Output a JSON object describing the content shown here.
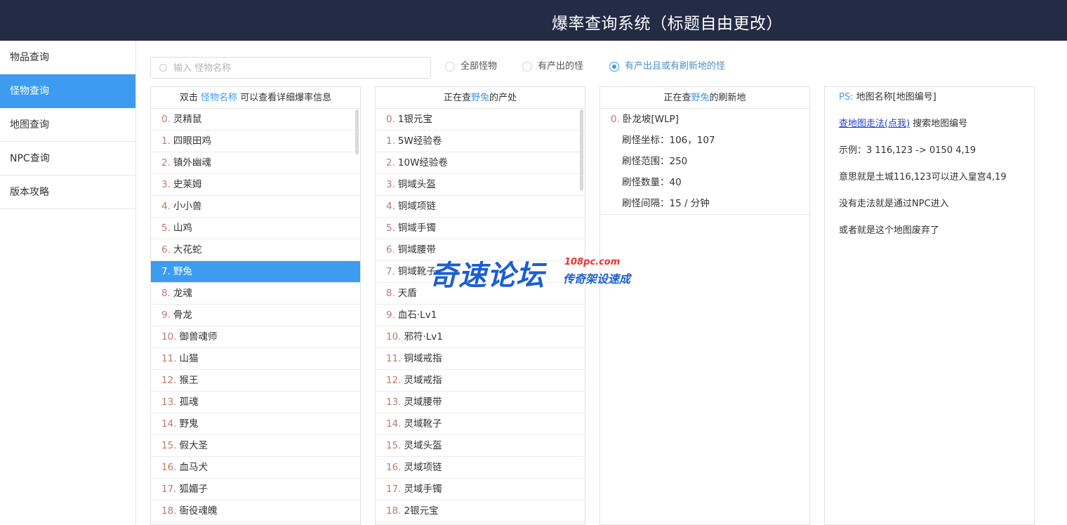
{
  "header": {
    "title": "爆率查询系统（标题自由更改）"
  },
  "sidebar": {
    "items": [
      {
        "label": "物品查询"
      },
      {
        "label": "怪物查询"
      },
      {
        "label": "地图查询"
      },
      {
        "label": "NPC查询"
      },
      {
        "label": "版本攻略"
      }
    ],
    "active_index": 1
  },
  "search": {
    "placeholder": "输入 怪物名称",
    "value": ""
  },
  "filters": {
    "options": [
      "全部怪物",
      "有产出的怪",
      "有产出且或有刷新地的怪"
    ],
    "selected": "有产出且或有刷新地的怪"
  },
  "monsters": {
    "header_prefix": "双击",
    "header_highlight": "怪物名称",
    "header_suffix": "可以查看详细爆率信息",
    "selected_index": 7,
    "items": [
      {
        "idx": "0.",
        "name": "灵精鼠"
      },
      {
        "idx": "1.",
        "name": "四眼田鸡"
      },
      {
        "idx": "2.",
        "name": "镇外幽魂"
      },
      {
        "idx": "3.",
        "name": "史莱姆"
      },
      {
        "idx": "4.",
        "name": "小小兽"
      },
      {
        "idx": "5.",
        "name": "山鸡"
      },
      {
        "idx": "6.",
        "name": "大花蛇"
      },
      {
        "idx": "7.",
        "name": "野兔"
      },
      {
        "idx": "8.",
        "name": "龙魂"
      },
      {
        "idx": "9.",
        "name": "骨龙"
      },
      {
        "idx": "10.",
        "name": "御兽魂师"
      },
      {
        "idx": "11.",
        "name": "山猫"
      },
      {
        "idx": "12.",
        "name": "猴王"
      },
      {
        "idx": "13.",
        "name": "孤魂"
      },
      {
        "idx": "14.",
        "name": "野鬼"
      },
      {
        "idx": "15.",
        "name": "假大圣"
      },
      {
        "idx": "16.",
        "name": "血马犬"
      },
      {
        "idx": "17.",
        "name": "狐媚子"
      },
      {
        "idx": "18.",
        "name": "衙役魂魄"
      }
    ]
  },
  "drops": {
    "header_prefix": "正在查",
    "header_highlight": "野兔",
    "header_suffix": "的产处",
    "items": [
      {
        "idx": "0.",
        "name": "1银元宝"
      },
      {
        "idx": "1.",
        "name": "5W经验卷"
      },
      {
        "idx": "2.",
        "name": "10W经验卷"
      },
      {
        "idx": "3.",
        "name": "铜域头盔"
      },
      {
        "idx": "4.",
        "name": "铜域项链"
      },
      {
        "idx": "5.",
        "name": "铜域手镯"
      },
      {
        "idx": "6.",
        "name": "铜域腰带"
      },
      {
        "idx": "7.",
        "name": "铜域靴子"
      },
      {
        "idx": "8.",
        "name": "天盾"
      },
      {
        "idx": "9.",
        "name": "血石·Lv1"
      },
      {
        "idx": "10.",
        "name": "邪符·Lv1"
      },
      {
        "idx": "11.",
        "name": "铜域戒指"
      },
      {
        "idx": "12.",
        "name": "灵域戒指"
      },
      {
        "idx": "13.",
        "name": "灵域腰带"
      },
      {
        "idx": "14.",
        "name": "灵域靴子"
      },
      {
        "idx": "15.",
        "name": "灵域头盔"
      },
      {
        "idx": "16.",
        "name": "灵域项链"
      },
      {
        "idx": "17.",
        "name": "灵域手镯"
      },
      {
        "idx": "18.",
        "name": "2银元宝"
      }
    ]
  },
  "spawns": {
    "header_prefix": "正在查",
    "header_highlight": "野兔",
    "header_suffix": "的刷新地",
    "map_idx": "0.",
    "map_name": "卧龙坡[WLP]",
    "coords": "刷怪坐标：106，107",
    "range": "刷怪范围：250",
    "count": "刷怪数量：40",
    "interval": "刷怪间隔：15 / 分钟"
  },
  "info": {
    "ps_label": "PS:",
    "ps_text": "地图名称[地图编号]",
    "link_text": "查地图走法(点我)",
    "link_suffix": " 搜索地图编号",
    "example": "示例：3 116,123 -> 0150 4,19",
    "meaning": "意思就是土城116,123可以进入皇宫4,19",
    "no_route": "没有走法就是通过NPC进入",
    "abandoned": "或者就是这个地图废弃了"
  },
  "watermark": {
    "main": "奇速论坛",
    "url": "108pc.com",
    "sub": "传奇架设速成"
  }
}
